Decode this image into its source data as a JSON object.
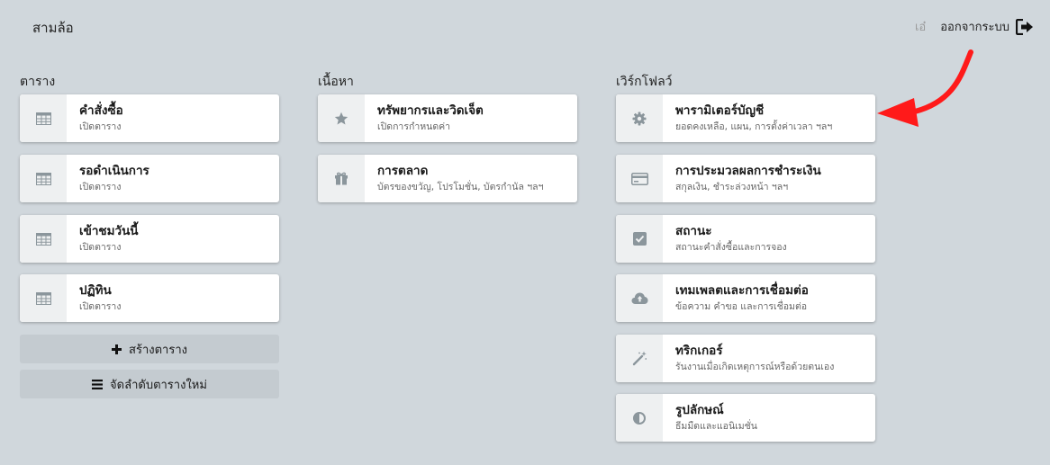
{
  "header": {
    "title": "สามล้อ",
    "user": "เอ๋",
    "logout_label": "ออกจากระบบ"
  },
  "columns": {
    "tables": {
      "title": "ตาราง",
      "items": [
        {
          "title": "คำสั่งซื้อ",
          "subtitle": "เปิดตาราง",
          "icon": "table-icon"
        },
        {
          "title": "รอดำเนินการ",
          "subtitle": "เปิดตาราง",
          "icon": "table-icon"
        },
        {
          "title": "เข้าชมวันนี้",
          "subtitle": "เปิดตาราง",
          "icon": "table-icon"
        },
        {
          "title": "ปฏิทิน",
          "subtitle": "เปิดตาราง",
          "icon": "table-icon"
        }
      ],
      "create_label": "สร้างตาราง",
      "reorder_label": "จัดลำดับตารางใหม่"
    },
    "content": {
      "title": "เนื้อหา",
      "items": [
        {
          "title": "ทรัพยากรและวิดเจ็ต",
          "subtitle": "เปิดการกำหนดค่า",
          "icon": "star-icon"
        },
        {
          "title": "การตลาด",
          "subtitle": "บัตรของขวัญ, โปรโมชั่น, บัตรกำนัล ฯลฯ",
          "icon": "gift-icon"
        }
      ]
    },
    "workflow": {
      "title": "เวิร์กโฟลว์",
      "items": [
        {
          "title": "พารามิเตอร์บัญชี",
          "subtitle": "ยอดคงเหลือ, แผน, การตั้งค่าเวลา ฯลฯ",
          "icon": "gear-icon"
        },
        {
          "title": "การประมวลผลการชำระเงิน",
          "subtitle": "สกุลเงิน, ชำระล่วงหน้า ฯลฯ",
          "icon": "credit-card-icon"
        },
        {
          "title": "สถานะ",
          "subtitle": "สถานะคำสั่งซื้อและการจอง",
          "icon": "checkbox-icon"
        },
        {
          "title": "เทมเพลตและการเชื่อมต่อ",
          "subtitle": "ข้อความ คำขอ และการเชื่อมต่อ",
          "icon": "cloud-icon"
        },
        {
          "title": "ทริกเกอร์",
          "subtitle": "รันงานเมื่อเกิดเหตุการณ์หรือด้วยตนเอง",
          "icon": "magic-wand-icon"
        },
        {
          "title": "รูปลักษณ์",
          "subtitle": "ธีมมืดและแอนิเมชั่น",
          "icon": "contrast-icon"
        }
      ]
    }
  },
  "colors": {
    "background": "#d0d7dc",
    "card": "#ffffff",
    "icon_bg": "#eef0f1",
    "icon": "#8b969c",
    "button": "#c4cbd0",
    "annotation_arrow": "#ff1a1a"
  }
}
